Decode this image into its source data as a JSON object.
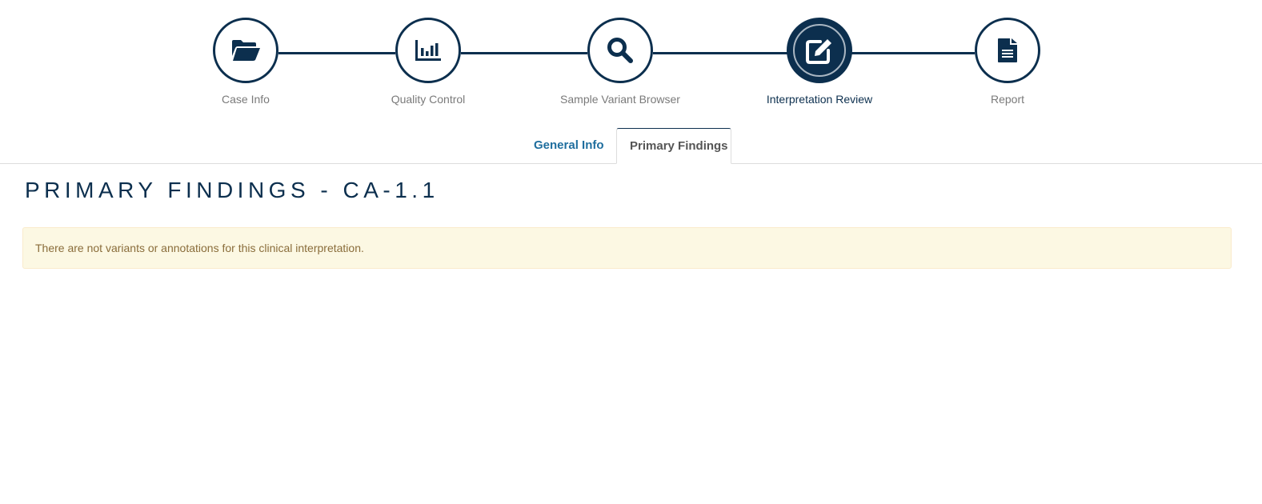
{
  "stepper": {
    "steps": [
      {
        "label": "Case Info",
        "icon": "folder-open-icon",
        "active": false
      },
      {
        "label": "Quality Control",
        "icon": "bar-chart-icon",
        "active": false
      },
      {
        "label": "Sample Variant Browser",
        "icon": "search-icon",
        "active": false
      },
      {
        "label": "Interpretation Review",
        "icon": "edit-icon",
        "active": true
      },
      {
        "label": "Report",
        "icon": "file-text-icon",
        "active": false
      }
    ]
  },
  "tabs": {
    "general_info": "General Info",
    "primary_findings": "Primary Findings",
    "active": "Primary Findings"
  },
  "main": {
    "title": "PRIMARY FINDINGS - CA-1.1",
    "alert_message": "There are not variants or annotations for this clinical interpretation."
  },
  "colors": {
    "primary": "#0c2f4e",
    "link": "#1f6e9e",
    "alert_bg": "#fcf8e3",
    "alert_border": "#faebcc",
    "alert_text": "#8a6d3b",
    "muted_text": "#7a7a7a"
  }
}
